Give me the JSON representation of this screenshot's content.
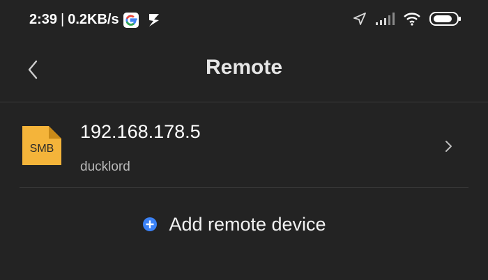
{
  "statusbar": {
    "time": "2:39",
    "separator": "|",
    "speed": "0.2KB/s",
    "icons": [
      "google-icon",
      "s-app-icon",
      "location-icon",
      "signal-icon",
      "wifi-icon",
      "battery-icon"
    ]
  },
  "header": {
    "title": "Remote",
    "back_icon": "chevron-left-icon"
  },
  "devices": [
    {
      "type_badge": "SMB",
      "name": "192.168.178.5",
      "user": "ducklord",
      "icon": "smb-folder-icon"
    }
  ],
  "actions": {
    "add_label": "Add remote device",
    "add_icon": "plus-circle-icon"
  },
  "colors": {
    "background": "#232323",
    "folder": "#f4b43a",
    "accent": "#3b82f6",
    "text": "#f2f2f2",
    "muted": "#b8b8b8"
  }
}
